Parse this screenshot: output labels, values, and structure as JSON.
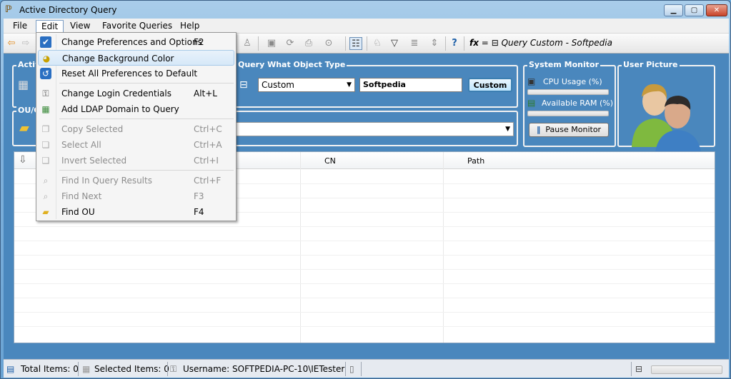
{
  "window": {
    "title": "Active Directory Query",
    "min_label": "▁",
    "max_label": "▢",
    "close_label": "✕"
  },
  "menubar": [
    "File",
    "Edit",
    "View",
    "Favorite Queries",
    "Help"
  ],
  "toolbar": {
    "fx_label": "fx",
    "eq_label": "=",
    "query_label": "Query Custom - Softpedia"
  },
  "groups": {
    "active_legend": "Activ",
    "ou_legend": "OU/C",
    "query_legend": "Query What Object Type",
    "monitor_legend": "System Monitor",
    "user_legend": "User Picture"
  },
  "query": {
    "type_value": "Custom",
    "text_value": "Softpedia",
    "button_label": "Custom"
  },
  "monitor": {
    "cpu_label": "CPU Usage (%)",
    "ram_label": "Available RAM (%)",
    "pause_label": "Pause Monitor",
    "cpu_pct": 0,
    "ram_pct": 0
  },
  "grid": {
    "columns": [
      "CN",
      "Path"
    ]
  },
  "status": {
    "total": "Total Items: 0",
    "selected": "Selected Items: 0",
    "username": "Username: SOFTPEDIA-PC-10\\IETester"
  },
  "edit_menu": [
    {
      "label": "Change Preferences and Options",
      "shortcut": "F2",
      "enabled": true,
      "icon": "check-icon"
    },
    {
      "label": "Change Background Color",
      "shortcut": "",
      "enabled": true,
      "icon": "palette-icon",
      "highlighted": true
    },
    {
      "label": "Reset All Preferences to Default",
      "shortcut": "",
      "enabled": true,
      "icon": "reset-icon"
    },
    {
      "label": "Change Login Credentials",
      "shortcut": "Alt+L",
      "enabled": true,
      "icon": "key-icon"
    },
    {
      "label": "Add LDAP Domain to Query",
      "shortcut": "",
      "enabled": true,
      "icon": "domain-icon"
    },
    {
      "label": "Copy Selected",
      "shortcut": "Ctrl+C",
      "enabled": false,
      "icon": "copy-icon"
    },
    {
      "label": "Select All",
      "shortcut": "Ctrl+A",
      "enabled": false,
      "icon": "select-all-icon"
    },
    {
      "label": "Invert Selected",
      "shortcut": "Ctrl+I",
      "enabled": false,
      "icon": "invert-icon"
    },
    {
      "label": "Find In Query Results",
      "shortcut": "Ctrl+F",
      "enabled": false,
      "icon": "find-icon"
    },
    {
      "label": "Find Next",
      "shortcut": "F3",
      "enabled": false,
      "icon": "find-next-icon"
    },
    {
      "label": "Find OU",
      "shortcut": "F4",
      "enabled": true,
      "icon": "folder-icon"
    }
  ]
}
